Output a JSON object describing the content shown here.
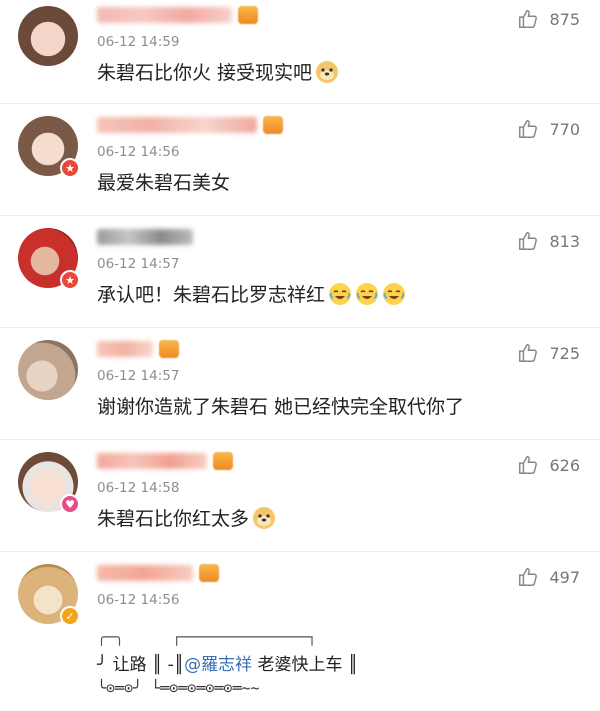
{
  "comments": [
    {
      "time": "06-12 14:59",
      "text": "朱碧石比你火 接受现实吧",
      "likes": "875",
      "emoji": [
        "doge-face-icon"
      ]
    },
    {
      "time": "06-12 14:56",
      "text": "最爱朱碧石美女",
      "likes": "770",
      "emoji": []
    },
    {
      "time": "06-12 14:57",
      "text": "承认吧！朱碧石比罗志祥红",
      "likes": "813",
      "emoji": [
        "laugh-cry-face-icon",
        "laugh-cry-face-icon",
        "laugh-cry-face-icon"
      ]
    },
    {
      "time": "06-12 14:57",
      "text": "谢谢你造就了朱碧石 她已经快完全取代你了",
      "likes": "725",
      "emoji": []
    },
    {
      "time": "06-12 14:58",
      "text": "朱碧石比你红太多",
      "likes": "626",
      "emoji": [
        "doge-face-icon"
      ]
    },
    {
      "time": "06-12 14:56",
      "text": "",
      "likes": "497",
      "emoji": []
    }
  ],
  "ascii_art": {
    "line1_left": "╭─╮",
    "line1_right": "┌──────────────┐",
    "line2_prefix": "╯ 让路 ║ -║",
    "line2_mention": "@羅志祥",
    "line2_suffix": " 老婆快上车 ║",
    "line3": "╰⊙═⊙╯    └═⊙═⊙═⊙═⊙═~~"
  },
  "colors": {
    "mention": "#3a6fb3",
    "badge_red": "#e6483a",
    "badge_pink": "#e94b8a",
    "badge_gold": "#f0a51b"
  }
}
